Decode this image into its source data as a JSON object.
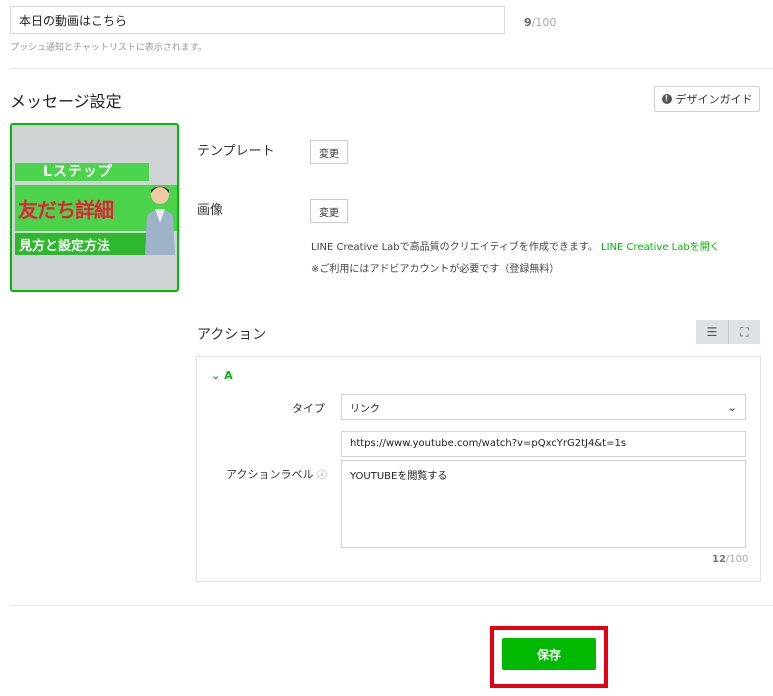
{
  "title_field": {
    "value": "本日の動画はこちら",
    "count_current": "9",
    "count_max": "/100",
    "hint": "プッシュ通知とチャットリストに表示されます。"
  },
  "message": {
    "section_title": "メッセージ設定",
    "guide_button": "デザインガイド"
  },
  "thumbnail": {
    "line1": "Lステップ",
    "line2": "友だち詳細",
    "line3": "見方と設定方法"
  },
  "template": {
    "label": "テンプレート",
    "change_button": "変更"
  },
  "image": {
    "label": "画像",
    "change_button": "変更",
    "note1": "LINE Creative Labで高品質のクリエイティブを作成できます。",
    "note1_link": "LINE Creative Labを開く",
    "note2": "※ご利用にはアドビアカウントが必要です（登録無料）"
  },
  "action": {
    "section_title": "アクション",
    "item_label": "A",
    "type_label": "タイプ",
    "type_value": "リンク",
    "url_value": "https://www.youtube.com/watch?v=pQxcYrG2tJ4&t=1s",
    "action_label_label": "アクションラベル",
    "action_label_value": "YOUTUBEを閲覧する",
    "count_current": "12",
    "count_max": "/100"
  },
  "save_button": "保存",
  "colors": {
    "accent": "#00b900",
    "highlight": "#e60012"
  }
}
